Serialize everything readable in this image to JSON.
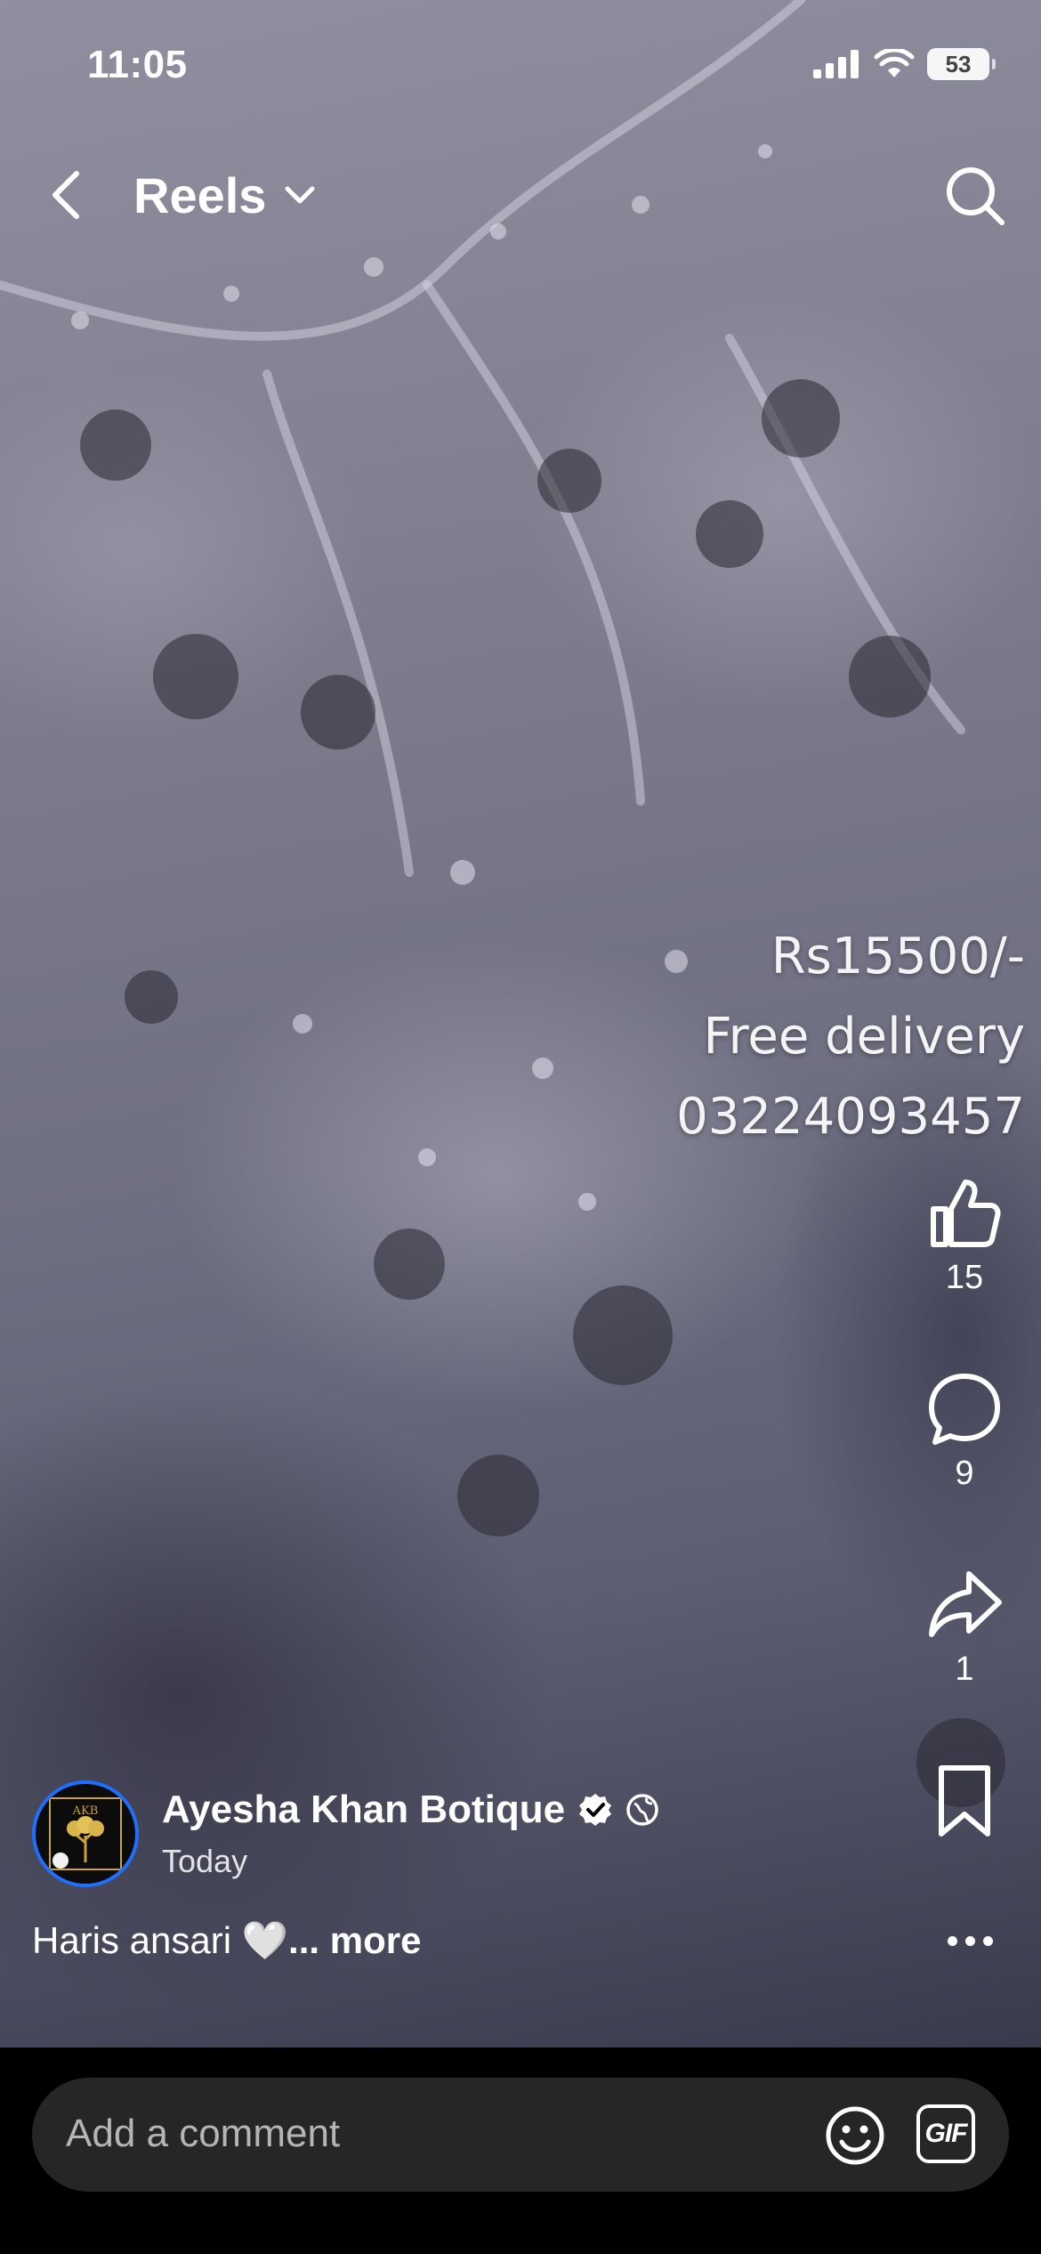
{
  "status_bar": {
    "time": "11:05",
    "battery": "53"
  },
  "header": {
    "title": "Reels"
  },
  "video_overlay": {
    "price": "Rs15500/-",
    "delivery": "Free delivery",
    "phone": "03224093457"
  },
  "actions": {
    "likes": "15",
    "comments": "9",
    "shares": "1"
  },
  "author": {
    "name": "Ayesha Khan Botique",
    "time": "Today",
    "avatar_text": "AKB"
  },
  "caption": {
    "text": "Haris ansari 🤍",
    "more": "... more"
  },
  "comment_bar": {
    "placeholder": "Add a comment",
    "gif_label": "GIF"
  },
  "icons": [
    "back-icon",
    "chevron-down-icon",
    "search-icon",
    "like-icon",
    "comment-icon",
    "share-icon",
    "bookmark-icon",
    "verified-icon",
    "globe-icon",
    "more-icon",
    "emoji-icon",
    "gif-icon",
    "signal-icon",
    "wifi-icon",
    "battery-icon"
  ]
}
